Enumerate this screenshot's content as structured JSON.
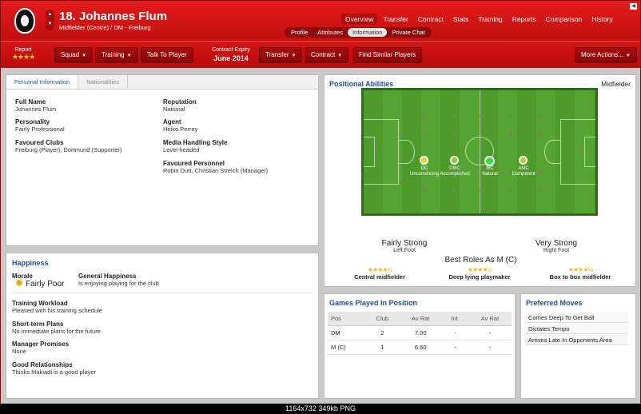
{
  "player": {
    "name": "18. Johannes Flum",
    "subtitle": "Midfielder (Centre) / DM - Freiburg"
  },
  "nav": {
    "main": [
      "Overview",
      "Transfer",
      "Contract",
      "Stats",
      "Training",
      "Reports",
      "Comparison",
      "History"
    ],
    "active_main": "Overview",
    "sub": [
      "Profile",
      "Attributes",
      "Information",
      "Private Chat"
    ],
    "active_sub": "Information"
  },
  "toolbar": {
    "report_label": "Report",
    "report_stars": "★★★★",
    "squad": "Squad",
    "training": "Training",
    "talk": "Talk To Player",
    "expiry_label": "Contract Expiry",
    "expiry_value": "June 2014",
    "transfer": "Transfer",
    "contract": "Contract",
    "similar": "Find Similar Players",
    "more": "More Actions..."
  },
  "personal": {
    "tabs": [
      "Personal Information",
      "Nationalities"
    ],
    "left": [
      {
        "label": "Full Name",
        "value": "Johannes Flum"
      },
      {
        "label": "Personality",
        "value": "Fairly Professional"
      },
      {
        "label": "Favoured Clubs",
        "value": "Freiburg (Player), Dortmund (Supporter)"
      }
    ],
    "right": [
      {
        "label": "Reputation",
        "value": "National"
      },
      {
        "label": "Agent",
        "value": "Heiko Perrey"
      },
      {
        "label": "Media Handling Style",
        "value": "Level-headed"
      },
      {
        "label": "Favoured Personnel",
        "value": "Robin Dutt, Christian Streich (Manager)"
      }
    ]
  },
  "happiness": {
    "title": "Happiness",
    "morale_label": "Morale",
    "morale_value": "Fairly Poor",
    "general_label": "General Happiness",
    "general_value": "Is enjoying playing for the club",
    "items": [
      {
        "label": "Training Workload",
        "value": "Pleased with his training schedule"
      },
      {
        "label": "Short-term Plans",
        "value": "No immediate plans for the future"
      },
      {
        "label": "Manager Promises",
        "value": "None"
      },
      {
        "label": "Good Relationships",
        "value": "Thinks Makiadi is a good player"
      }
    ]
  },
  "positional": {
    "title": "Positional Abilities",
    "position": "Midfielder",
    "positions": [
      {
        "code": "DC",
        "rating": "Unconvincing",
        "color": "#e4d616"
      },
      {
        "code": "DMC",
        "rating": "Accomplished",
        "color": "#7fd31e"
      },
      {
        "code": "MC",
        "rating": "Natural",
        "color": "#2fe43a"
      },
      {
        "code": "AMC",
        "rating": "Competent",
        "color": "#b5d01e"
      }
    ],
    "left_foot": {
      "strength": "Fairly Strong",
      "label": "Left Foot"
    },
    "right_foot": {
      "strength": "Very Strong",
      "label": "Right Foot"
    },
    "best_roles_title": "Best Roles As M (C)",
    "roles": [
      {
        "stars": "★★★★½",
        "name": "Central midfielder"
      },
      {
        "stars": "★★★★½",
        "name": "Deep lying playmaker"
      },
      {
        "stars": "★★★★½",
        "name": "Box to box midfielder"
      }
    ]
  },
  "games": {
    "title": "Games Played In Position",
    "headers": [
      "Pos",
      "Club",
      "Av Rat",
      "Int.",
      "Av Rat"
    ],
    "rows": [
      [
        "DM",
        "2",
        "7.00",
        "-",
        "-"
      ],
      [
        "M (C)",
        "1",
        "6.60",
        "-",
        "-"
      ]
    ]
  },
  "moves": {
    "title": "Preferred Moves",
    "items": [
      "Comes Deep To Get Ball",
      "Dictates Tempo",
      "Arrives Late In Opponents Area"
    ]
  },
  "footer": {
    "caption": "1164x732  349kb  PNG"
  }
}
